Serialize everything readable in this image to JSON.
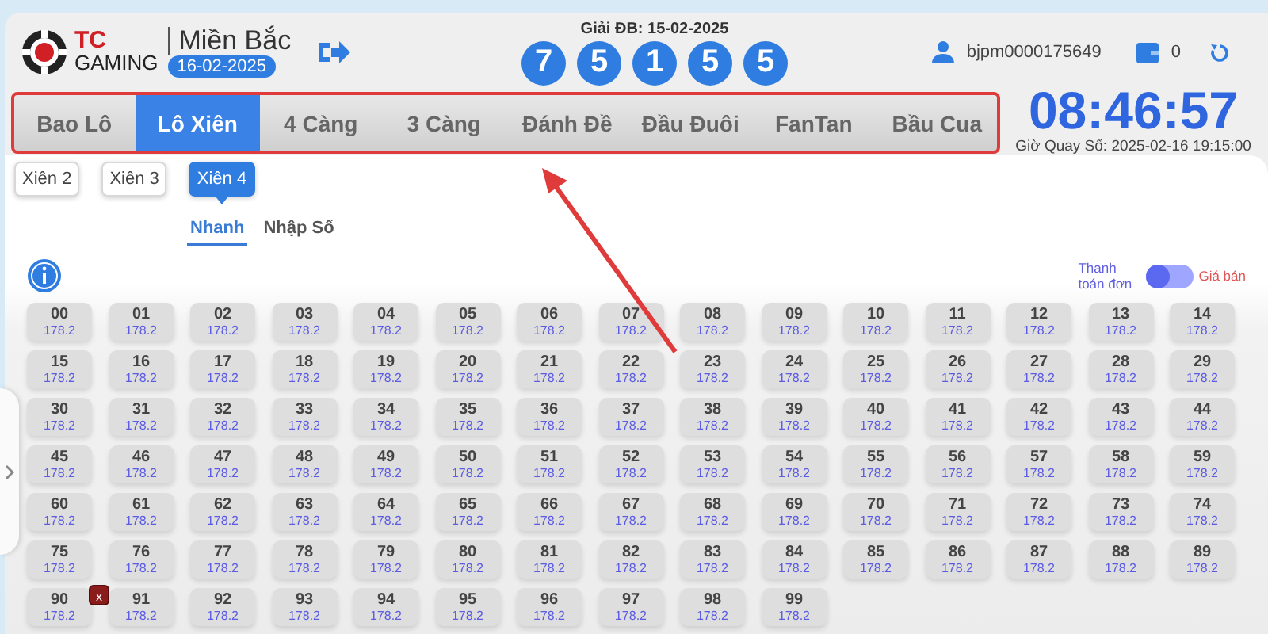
{
  "header": {
    "logo": {
      "mark": "TC",
      "name": "GAMING"
    },
    "region": "Miền Bắc",
    "date": "16-02-2025",
    "special_prize": {
      "label": "Giải ĐB: 15-02-2025",
      "digits": [
        "7",
        "5",
        "1",
        "5",
        "5"
      ]
    },
    "user": "bjpm0000175649",
    "balance": "0"
  },
  "tabs": [
    {
      "label": "Bao Lô",
      "selected": false
    },
    {
      "label": "Lô Xiên",
      "selected": true
    },
    {
      "label": "4 Càng",
      "selected": false
    },
    {
      "label": "3 Càng",
      "selected": false
    },
    {
      "label": "Đánh Đề",
      "selected": false
    },
    {
      "label": "Đầu Đuôi",
      "selected": false
    },
    {
      "label": "FanTan",
      "selected": false
    },
    {
      "label": "Bầu Cua",
      "selected": false
    }
  ],
  "clock": {
    "time": "08:46:57",
    "draw_time": "Giờ Quay Số: 2025-02-16 19:15:00"
  },
  "sub_tabs": [
    {
      "label": "Xiên 2",
      "selected": false
    },
    {
      "label": "Xiên 3",
      "selected": false
    },
    {
      "label": "Xiên 4",
      "selected": true
    }
  ],
  "modes": [
    {
      "label": "Nhanh",
      "selected": true
    },
    {
      "label": "Nhập Số",
      "selected": false
    }
  ],
  "toggle": {
    "left_label": "Thanh toán đơn",
    "right_label": "Giá bán",
    "on": false
  },
  "numbers": [
    {
      "number": "00",
      "price": "178.2"
    },
    {
      "number": "01",
      "price": "178.2"
    },
    {
      "number": "02",
      "price": "178.2"
    },
    {
      "number": "03",
      "price": "178.2"
    },
    {
      "number": "04",
      "price": "178.2"
    },
    {
      "number": "05",
      "price": "178.2"
    },
    {
      "number": "06",
      "price": "178.2"
    },
    {
      "number": "07",
      "price": "178.2"
    },
    {
      "number": "08",
      "price": "178.2"
    },
    {
      "number": "09",
      "price": "178.2"
    },
    {
      "number": "10",
      "price": "178.2"
    },
    {
      "number": "11",
      "price": "178.2"
    },
    {
      "number": "12",
      "price": "178.2"
    },
    {
      "number": "13",
      "price": "178.2"
    },
    {
      "number": "14",
      "price": "178.2"
    },
    {
      "number": "15",
      "price": "178.2"
    },
    {
      "number": "16",
      "price": "178.2"
    },
    {
      "number": "17",
      "price": "178.2"
    },
    {
      "number": "18",
      "price": "178.2"
    },
    {
      "number": "19",
      "price": "178.2"
    },
    {
      "number": "20",
      "price": "178.2"
    },
    {
      "number": "21",
      "price": "178.2"
    },
    {
      "number": "22",
      "price": "178.2"
    },
    {
      "number": "23",
      "price": "178.2"
    },
    {
      "number": "24",
      "price": "178.2"
    },
    {
      "number": "25",
      "price": "178.2"
    },
    {
      "number": "26",
      "price": "178.2"
    },
    {
      "number": "27",
      "price": "178.2"
    },
    {
      "number": "28",
      "price": "178.2"
    },
    {
      "number": "29",
      "price": "178.2"
    },
    {
      "number": "30",
      "price": "178.2"
    },
    {
      "number": "31",
      "price": "178.2"
    },
    {
      "number": "32",
      "price": "178.2"
    },
    {
      "number": "33",
      "price": "178.2"
    },
    {
      "number": "34",
      "price": "178.2"
    },
    {
      "number": "35",
      "price": "178.2"
    },
    {
      "number": "36",
      "price": "178.2"
    },
    {
      "number": "37",
      "price": "178.2"
    },
    {
      "number": "38",
      "price": "178.2"
    },
    {
      "number": "39",
      "price": "178.2"
    },
    {
      "number": "40",
      "price": "178.2"
    },
    {
      "number": "41",
      "price": "178.2"
    },
    {
      "number": "42",
      "price": "178.2"
    },
    {
      "number": "43",
      "price": "178.2"
    },
    {
      "number": "44",
      "price": "178.2"
    },
    {
      "number": "45",
      "price": "178.2"
    },
    {
      "number": "46",
      "price": "178.2"
    },
    {
      "number": "47",
      "price": "178.2"
    },
    {
      "number": "48",
      "price": "178.2"
    },
    {
      "number": "49",
      "price": "178.2"
    },
    {
      "number": "50",
      "price": "178.2"
    },
    {
      "number": "51",
      "price": "178.2"
    },
    {
      "number": "52",
      "price": "178.2"
    },
    {
      "number": "53",
      "price": "178.2"
    },
    {
      "number": "54",
      "price": "178.2"
    },
    {
      "number": "55",
      "price": "178.2"
    },
    {
      "number": "56",
      "price": "178.2"
    },
    {
      "number": "57",
      "price": "178.2"
    },
    {
      "number": "58",
      "price": "178.2"
    },
    {
      "number": "59",
      "price": "178.2"
    },
    {
      "number": "60",
      "price": "178.2"
    },
    {
      "number": "61",
      "price": "178.2"
    },
    {
      "number": "62",
      "price": "178.2"
    },
    {
      "number": "63",
      "price": "178.2"
    },
    {
      "number": "64",
      "price": "178.2"
    },
    {
      "number": "65",
      "price": "178.2"
    },
    {
      "number": "66",
      "price": "178.2"
    },
    {
      "number": "67",
      "price": "178.2"
    },
    {
      "number": "68",
      "price": "178.2"
    },
    {
      "number": "69",
      "price": "178.2"
    },
    {
      "number": "70",
      "price": "178.2"
    },
    {
      "number": "71",
      "price": "178.2"
    },
    {
      "number": "72",
      "price": "178.2"
    },
    {
      "number": "73",
      "price": "178.2"
    },
    {
      "number": "74",
      "price": "178.2"
    },
    {
      "number": "75",
      "price": "178.2"
    },
    {
      "number": "76",
      "price": "178.2"
    },
    {
      "number": "77",
      "price": "178.2"
    },
    {
      "number": "78",
      "price": "178.2"
    },
    {
      "number": "79",
      "price": "178.2"
    },
    {
      "number": "80",
      "price": "178.2"
    },
    {
      "number": "81",
      "price": "178.2"
    },
    {
      "number": "82",
      "price": "178.2"
    },
    {
      "number": "83",
      "price": "178.2"
    },
    {
      "number": "84",
      "price": "178.2"
    },
    {
      "number": "85",
      "price": "178.2"
    },
    {
      "number": "86",
      "price": "178.2"
    },
    {
      "number": "87",
      "price": "178.2"
    },
    {
      "number": "88",
      "price": "178.2"
    },
    {
      "number": "89",
      "price": "178.2"
    },
    {
      "number": "90",
      "price": "178.2",
      "badge": "x"
    },
    {
      "number": "91",
      "price": "178.2"
    },
    {
      "number": "92",
      "price": "178.2"
    },
    {
      "number": "93",
      "price": "178.2"
    },
    {
      "number": "94",
      "price": "178.2"
    },
    {
      "number": "95",
      "price": "178.2"
    },
    {
      "number": "96",
      "price": "178.2"
    },
    {
      "number": "97",
      "price": "178.2"
    },
    {
      "number": "98",
      "price": "178.2"
    },
    {
      "number": "99",
      "price": "178.2"
    }
  ],
  "annotation": {
    "kind": "arrow-highlight"
  }
}
